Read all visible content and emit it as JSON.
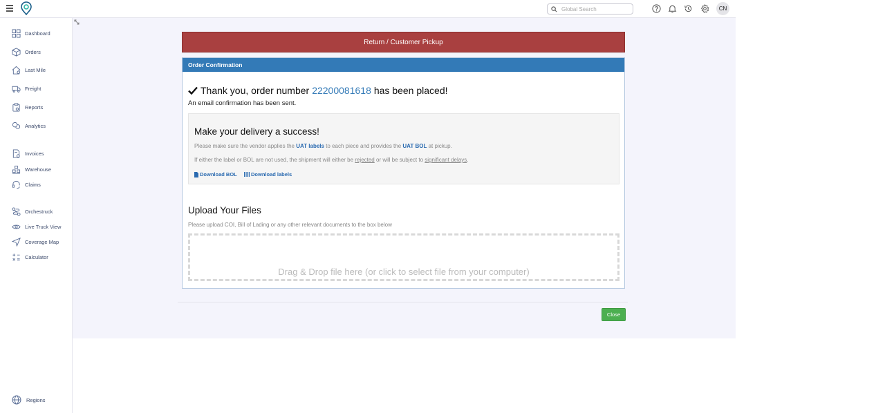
{
  "header": {
    "search": {
      "placeholder": "Global Search"
    },
    "icons": [
      "help-icon",
      "bell-icon",
      "history-icon",
      "gear-icon"
    ],
    "avatar_initials": "CN"
  },
  "sidebar": {
    "items": [
      {
        "label": "Dashboard",
        "icon": "dashboard-icon"
      },
      {
        "label": "Orders",
        "icon": "box-icon"
      },
      {
        "label": "Last Mile",
        "icon": "house-icon"
      },
      {
        "label": "Freight",
        "icon": "truck-icon"
      },
      {
        "label": "Reports",
        "icon": "clipboard-icon"
      },
      {
        "label": "Analytics",
        "icon": "analytics-icon"
      },
      {
        "label": "Invoices",
        "icon": "invoice-icon"
      },
      {
        "label": "Warehouse",
        "icon": "warehouse-icon"
      },
      {
        "label": "Claims",
        "icon": "headset-icon"
      },
      {
        "label": "Orchestruck",
        "icon": "route-icon"
      },
      {
        "label": "Live Truck View",
        "icon": "eye-icon"
      },
      {
        "label": "Coverage Map",
        "icon": "navigation-icon"
      },
      {
        "label": "Calculator",
        "icon": "calculator-icon"
      }
    ],
    "footer": {
      "label": "Regions",
      "icon": "globe-icon"
    }
  },
  "banner": {
    "title": "Return / Customer Pickup",
    "color": "#a94040"
  },
  "panel": {
    "header": "Order Confirmation",
    "header_color": "#337ab7",
    "thanks_prefix": "Thank you, order number",
    "order_number": "22200081618",
    "thanks_suffix": "has been placed!",
    "email_sent": "An email confirmation has been sent."
  },
  "success": {
    "title": "Make your delivery a success!",
    "line1": {
      "a": "Please make sure the vendor applies the",
      "labels": "UAT labels",
      "b": "to each piece and provides the",
      "bol": "UAT BOL",
      "c": "at pickup."
    },
    "line2": {
      "a": "If either the label or BOL are not used, the shipment will either be",
      "rejected": "rejected",
      "b": "or will be subject to",
      "delays": "significant delays",
      "c": "."
    },
    "download_bol": "Download BOL",
    "download_labels": "Download labels"
  },
  "upload": {
    "title": "Upload Your Files",
    "description": "Please upload COI, Bill of Lading or any other relevant documents to the box below",
    "dropzone_text": "Drag & Drop file here (or click to select file from your computer)"
  },
  "footer": {
    "close_label": "Close",
    "close_color": "#4caf50"
  }
}
